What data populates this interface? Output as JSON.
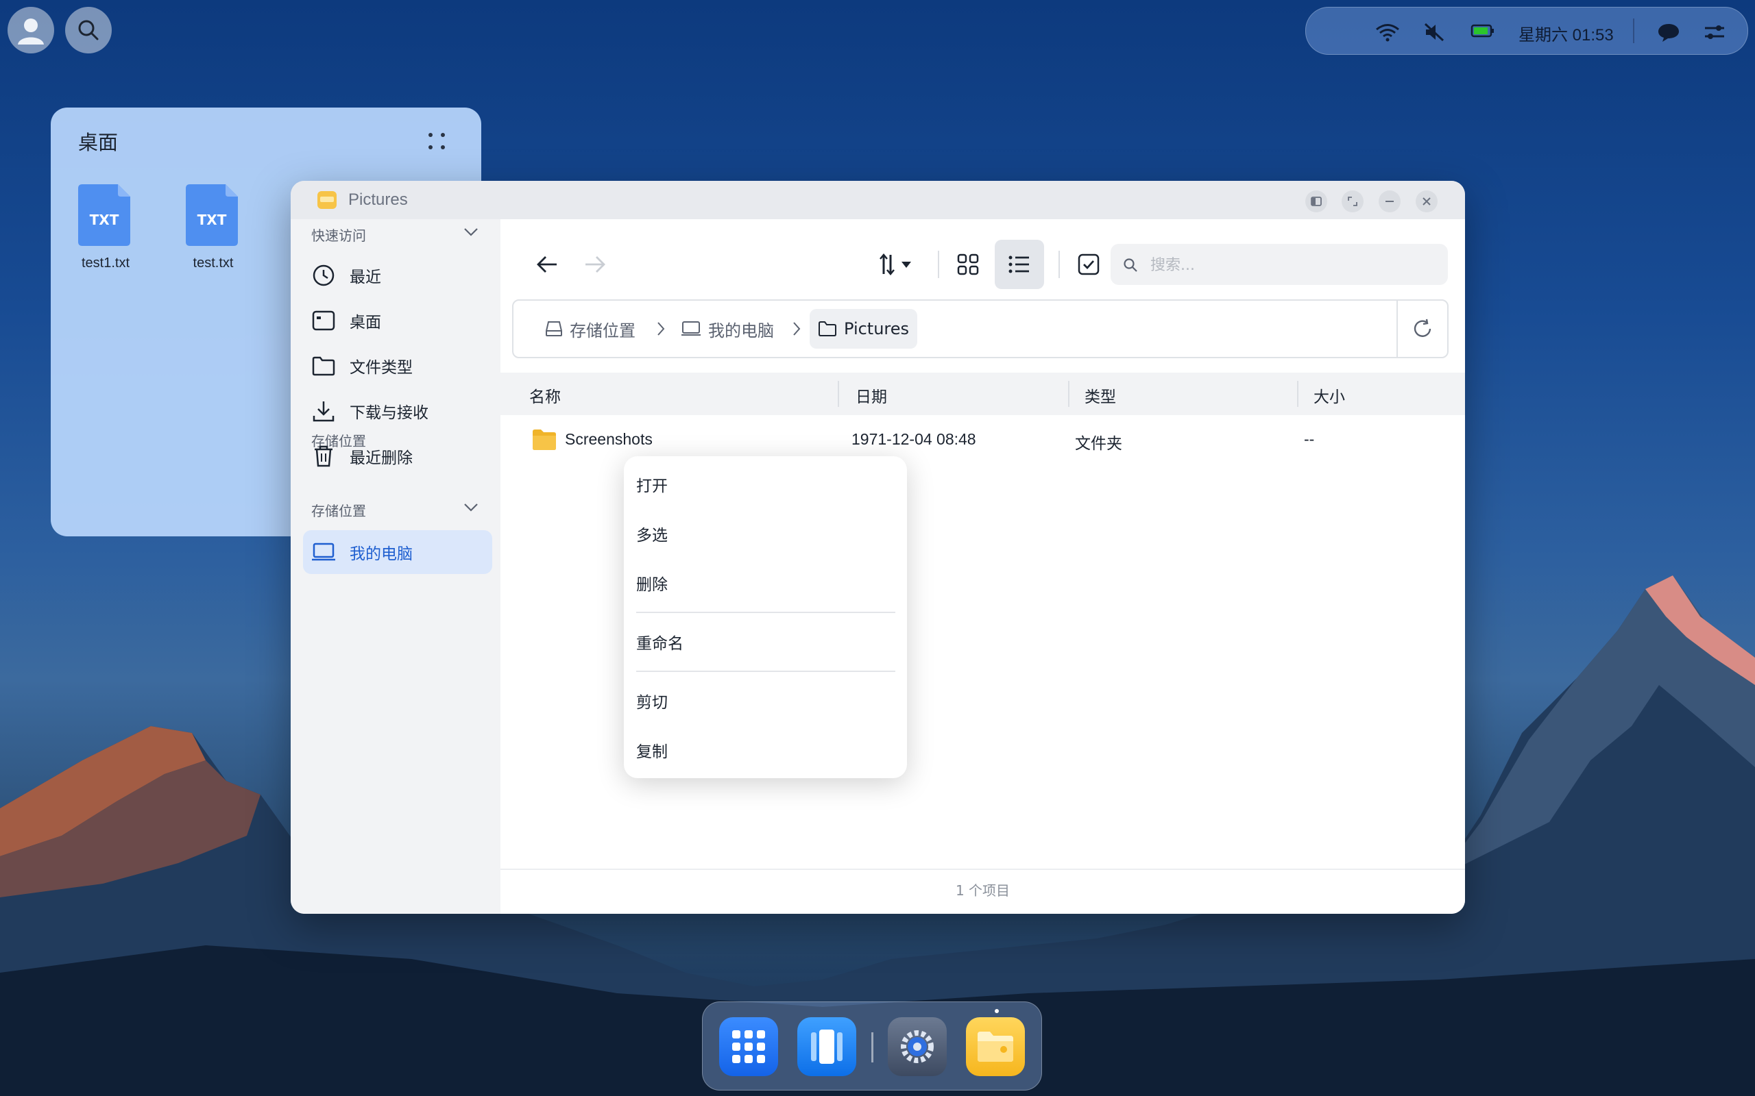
{
  "status_bar": {
    "time": "星期六 01:53"
  },
  "widget": {
    "title": "桌面",
    "files": [
      {
        "label": "test1.txt",
        "badge": "TXT"
      },
      {
        "label": "test.txt",
        "badge": "TXT"
      }
    ]
  },
  "window": {
    "title": "Pictures",
    "sidebar": {
      "quick_access": "快速访问",
      "items": [
        {
          "label": "最近",
          "icon": "clock-icon"
        },
        {
          "label": "桌面",
          "icon": "desktop-icon"
        },
        {
          "label": "文件类型",
          "icon": "folder-icon"
        },
        {
          "label": "下载与接收",
          "icon": "download-icon"
        },
        {
          "label": "最近删除",
          "icon": "trash-icon"
        }
      ],
      "storage": "存储位置",
      "storage_items": [
        {
          "label": "我的电脑",
          "icon": "laptop-icon"
        }
      ]
    },
    "search": {
      "placeholder": "搜索..."
    },
    "breadcrumb": [
      "存储位置",
      "我的电脑",
      "Pictures"
    ],
    "columns": {
      "name": "名称",
      "date": "日期",
      "type": "类型",
      "size": "大小"
    },
    "rows": [
      {
        "name": "Screenshots",
        "date": "1971-12-04 08:48",
        "type": "文件夹",
        "size": "--"
      }
    ],
    "footer": "1 个项目"
  },
  "context_menu": {
    "items": [
      "打开",
      "多选",
      "删除",
      "重命名",
      "剪切",
      "复制"
    ]
  },
  "colors": {
    "accent": "#1f5fd0",
    "folder": "#f7c447"
  }
}
